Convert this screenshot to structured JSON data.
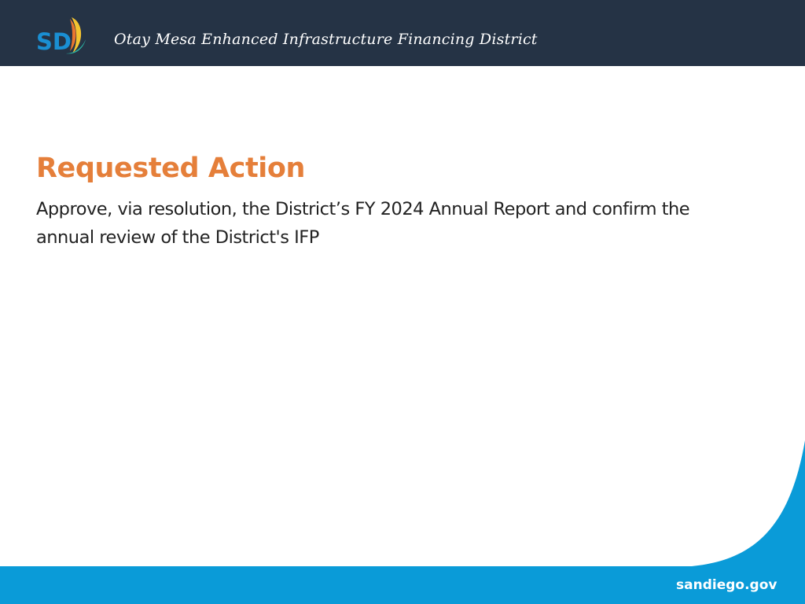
{
  "header": {
    "logo_icon": "city-of-san-diego-logo-icon",
    "logo_text": "SD",
    "title": "Otay Mesa Enhanced Infrastructure Financing District"
  },
  "slide": {
    "heading": "Requested Action",
    "body": "Approve, via resolution, the District’s FY 2024 Annual Report and confirm the annual review of the District's IFP"
  },
  "footer": {
    "url": "sandiego.gov"
  },
  "colors": {
    "header_bg": "#253345",
    "heading": "#e57f3a",
    "footer_blue": "#0a9bd8",
    "logo_blue": "#1a8fd3",
    "logo_yellow": "#f4c430",
    "logo_orange": "#e8762f",
    "logo_teal": "#2bb3a3"
  }
}
